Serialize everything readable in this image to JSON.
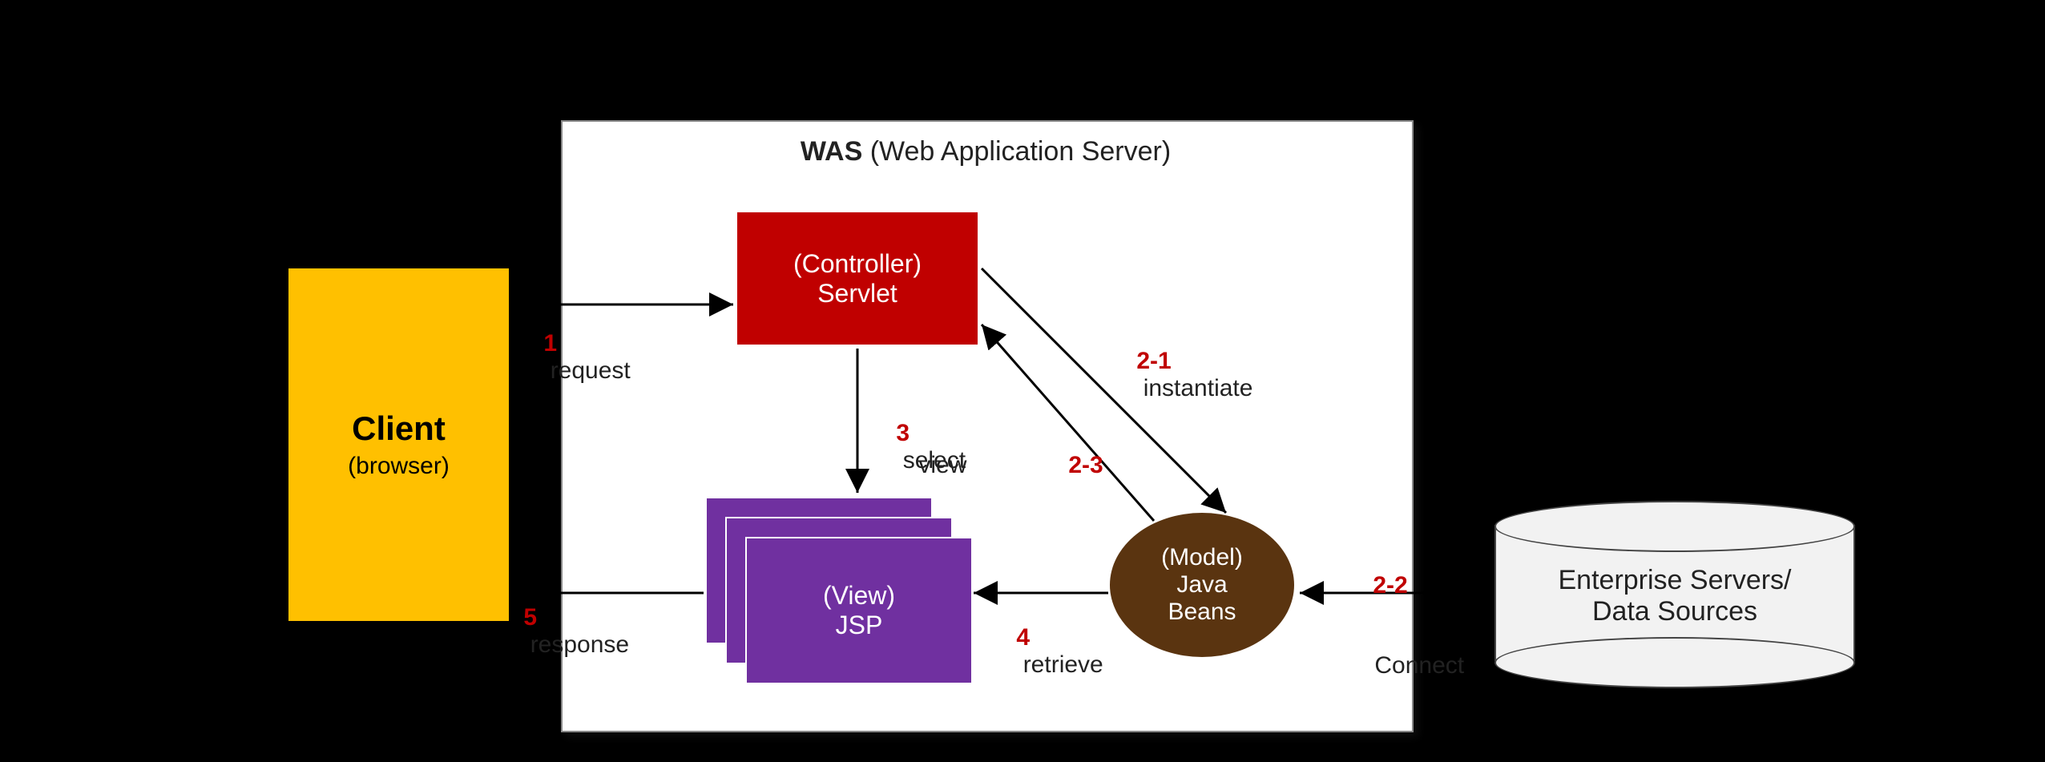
{
  "client": {
    "title": "Client",
    "subtitle": "(browser)"
  },
  "was": {
    "title_bold": "WAS",
    "title_rest": " (Web Application Server)"
  },
  "controller": {
    "role": "(Controller)",
    "name": "Servlet"
  },
  "view": {
    "role": "(View)",
    "name": "JSP"
  },
  "model": {
    "role": "(Model)",
    "name1": "Java",
    "name2": "Beans"
  },
  "db": {
    "line1": "Enterprise Servers/",
    "line2": "Data Sources"
  },
  "labels": {
    "request": "request",
    "response": "response",
    "select_view_1": "select",
    "select_view_2": "view",
    "instantiate": "instantiate",
    "retrieve": "retrieve",
    "connect": "Connect"
  },
  "steps": {
    "s1": "1",
    "s2_1": "2-1",
    "s2_2": "2-2",
    "s2_3": "2-3",
    "s3": "3",
    "s4": "4",
    "s5": "5"
  }
}
